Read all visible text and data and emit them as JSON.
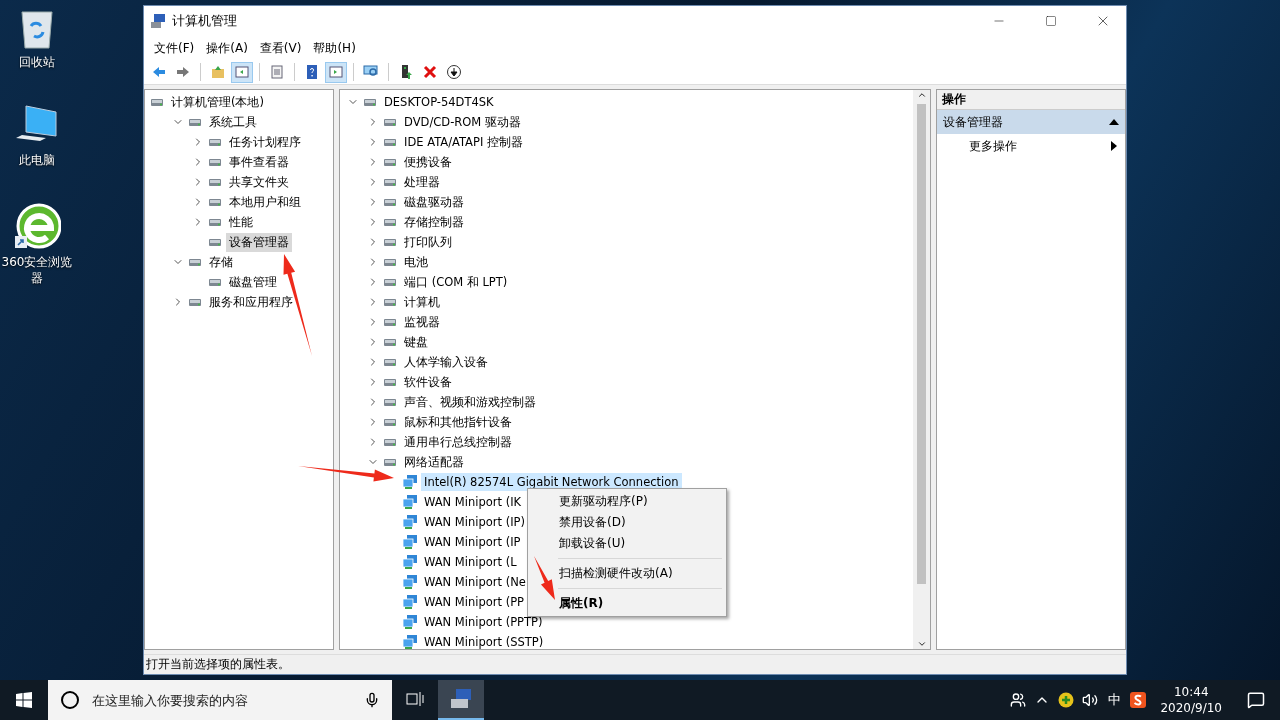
{
  "desktop_icons": [
    {
      "label": "回收站"
    },
    {
      "label": "此电脑"
    },
    {
      "label": "360安全浏览器"
    }
  ],
  "window": {
    "title": "计算机管理"
  },
  "menu": [
    "文件(F)",
    "操作(A)",
    "查看(V)",
    "帮助(H)"
  ],
  "toolbar": [
    {
      "kind": "back",
      "pressed": false
    },
    {
      "kind": "forward",
      "pressed": false
    },
    {
      "kind": "separator"
    },
    {
      "kind": "up",
      "pressed": false
    },
    {
      "kind": "tree",
      "pressed": true
    },
    {
      "kind": "separator"
    },
    {
      "kind": "sheet",
      "pressed": false
    },
    {
      "kind": "separator"
    },
    {
      "kind": "help",
      "pressed": false
    },
    {
      "kind": "pane",
      "pressed": true
    },
    {
      "kind": "separator"
    },
    {
      "kind": "scan",
      "pressed": false
    },
    {
      "kind": "separator"
    },
    {
      "kind": "update",
      "pressed": false
    },
    {
      "kind": "remove",
      "pressed": false
    },
    {
      "kind": "down",
      "pressed": false
    }
  ],
  "left_tree": {
    "label": "计算机管理(本地)",
    "selected": false,
    "children": [
      {
        "label": "系统工具",
        "expanded": true,
        "selected": false,
        "children": [
          {
            "label": "任务计划程序",
            "expanded": false,
            "selected": false
          },
          {
            "label": "事件查看器",
            "expanded": false,
            "selected": false
          },
          {
            "label": "共享文件夹",
            "expanded": false,
            "selected": false
          },
          {
            "label": "本地用户和组",
            "expanded": false,
            "selected": false
          },
          {
            "label": "性能",
            "expanded": false,
            "selected": false
          },
          {
            "label": "设备管理器",
            "selected": true
          }
        ]
      },
      {
        "label": "存储",
        "expanded": true,
        "selected": false,
        "children": [
          {
            "label": "磁盘管理",
            "selected": false
          }
        ]
      },
      {
        "label": "服务和应用程序",
        "expanded": false,
        "selected": false
      }
    ]
  },
  "device_tree": {
    "label": "DESKTOP-54DT4SK",
    "expanded": true,
    "selected": false,
    "children": [
      {
        "label": "DVD/CD-ROM 驱动器",
        "expanded": false,
        "selected": false
      },
      {
        "label": "IDE ATA/ATAPI 控制器",
        "expanded": false,
        "selected": false
      },
      {
        "label": "便携设备",
        "expanded": false,
        "selected": false
      },
      {
        "label": "处理器",
        "expanded": false,
        "selected": false
      },
      {
        "label": "磁盘驱动器",
        "expanded": false,
        "selected": false
      },
      {
        "label": "存储控制器",
        "expanded": false,
        "selected": false
      },
      {
        "label": "打印队列",
        "expanded": false,
        "selected": false
      },
      {
        "label": "电池",
        "expanded": false,
        "selected": false
      },
      {
        "label": "端口 (COM 和 LPT)",
        "expanded": false,
        "selected": false
      },
      {
        "label": "计算机",
        "expanded": false,
        "selected": false
      },
      {
        "label": "监视器",
        "expanded": false,
        "selected": false
      },
      {
        "label": "键盘",
        "expanded": false,
        "selected": false
      },
      {
        "label": "人体学输入设备",
        "expanded": false,
        "selected": false
      },
      {
        "label": "软件设备",
        "expanded": false,
        "selected": false
      },
      {
        "label": "声音、视频和游戏控制器",
        "expanded": false,
        "selected": false
      },
      {
        "label": "鼠标和其他指针设备",
        "expanded": false,
        "selected": false
      },
      {
        "label": "通用串行总线控制器",
        "expanded": false,
        "selected": false
      },
      {
        "label": "网络适配器",
        "expanded": true,
        "selected": false,
        "children": [
          {
            "label": "Intel(R) 82574L Gigabit Network Connection",
            "selected": true
          },
          {
            "label": "WAN Miniport (IK",
            "selected": false
          },
          {
            "label": "WAN Miniport (IP)",
            "selected": false
          },
          {
            "label": "WAN Miniport (IP",
            "selected": false
          },
          {
            "label": "WAN Miniport (L",
            "selected": false
          },
          {
            "label": "WAN Miniport (Ne",
            "selected": false
          },
          {
            "label": "WAN Miniport (PP",
            "selected": false
          },
          {
            "label": "WAN Miniport (PPTP)",
            "selected": false
          },
          {
            "label": "WAN Miniport (SSTP)",
            "selected": false
          }
        ]
      }
    ]
  },
  "actions": {
    "header": "操作",
    "section": {
      "label": "设备管理器",
      "expanded": true
    },
    "items": [
      "更多操作"
    ]
  },
  "context_menu": [
    {
      "kind": "item",
      "label": "更新驱动程序(P)",
      "default": false
    },
    {
      "kind": "item",
      "label": "禁用设备(D)",
      "default": false
    },
    {
      "kind": "item",
      "label": "卸载设备(U)",
      "default": false
    },
    {
      "kind": "separator"
    },
    {
      "kind": "item",
      "label": "扫描检测硬件改动(A)",
      "default": false
    },
    {
      "kind": "separator"
    },
    {
      "kind": "item",
      "label": "属性(R)",
      "default": true
    }
  ],
  "status_bar": "打开当前选择项的属性表。",
  "taskbar": {
    "search_placeholder": "在这里输入你要搜索的内容",
    "ime": "中",
    "time": "10:44",
    "date": "2020/9/10"
  }
}
